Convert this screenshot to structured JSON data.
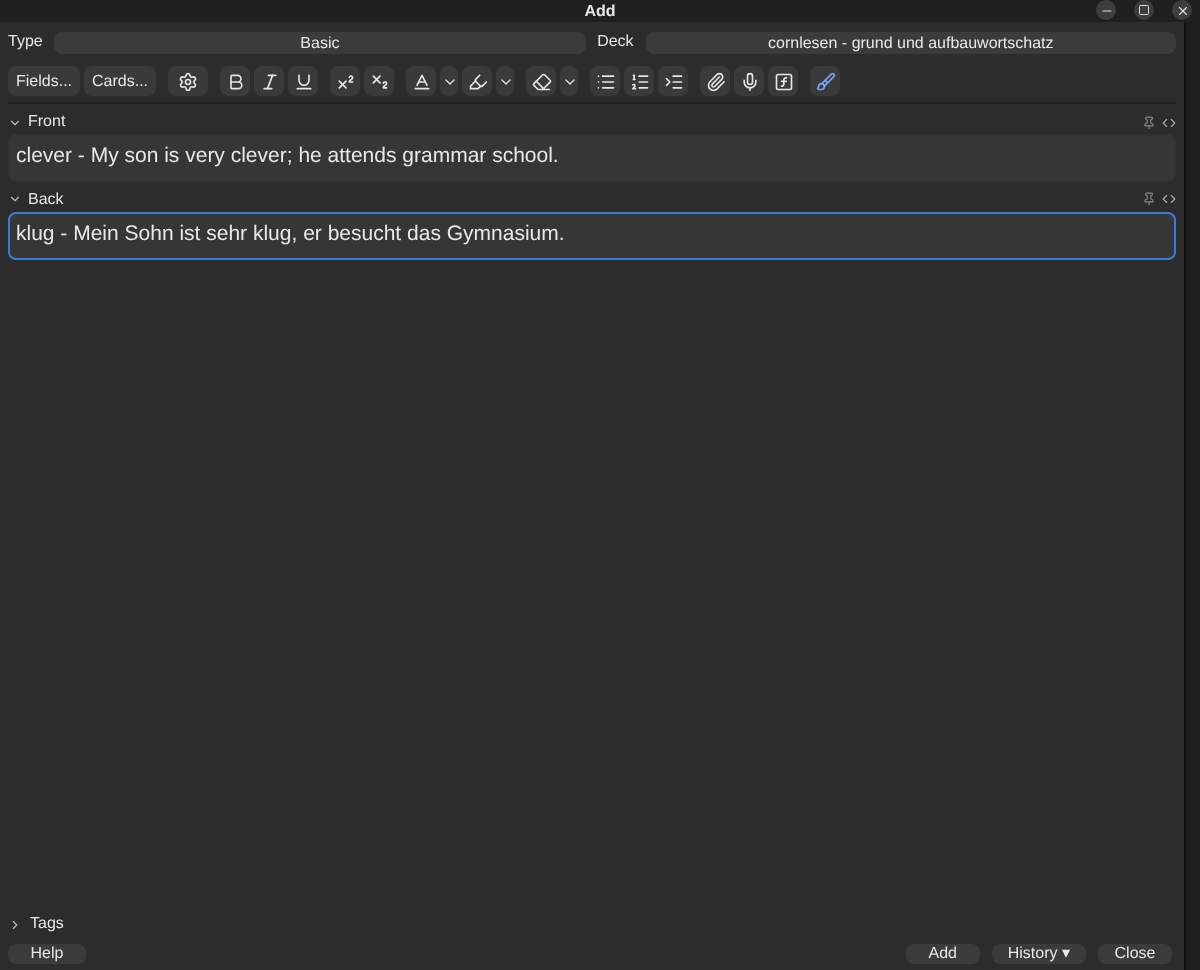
{
  "window": {
    "title": "Add"
  },
  "type": {
    "label": "Type",
    "value": "Basic"
  },
  "deck": {
    "label": "Deck",
    "value": "cornlesen - grund und aufbauwortschatz"
  },
  "toolbar": {
    "buttons": [
      "Fields...",
      "Cards..."
    ]
  },
  "fields": [
    {
      "name": "Front",
      "expanded": true,
      "focused": false,
      "value": "clever - My son is very clever; he attends grammar school."
    },
    {
      "name": "Back",
      "expanded": true,
      "focused": true,
      "value": "klug - Mein Sohn ist sehr klug, er besucht das Gymnasium."
    }
  ],
  "tags": {
    "label": "Tags",
    "expanded": false
  },
  "footer": {
    "left": [
      "Help"
    ],
    "right": [
      "Add",
      "History ▾",
      "Close"
    ]
  }
}
